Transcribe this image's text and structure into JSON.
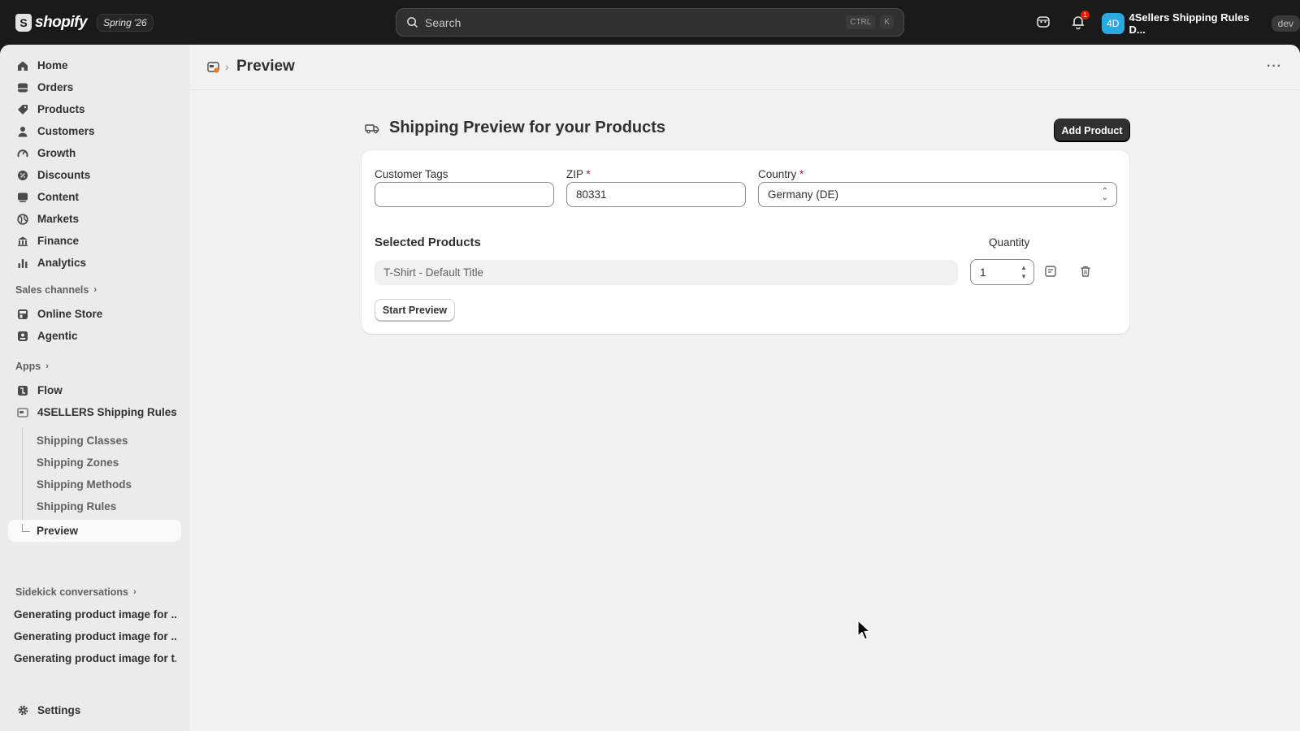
{
  "topbar": {
    "brand_name": "shopify",
    "brand_logo_letter": "S",
    "version": "Spring '26",
    "search_placeholder": "Search",
    "shortcut_keys": [
      "CTRL",
      "K"
    ],
    "notification_count": "1",
    "store_initials": "4D",
    "store_name": "4Sellers Shipping Rules D...",
    "env_badge": "dev"
  },
  "sidebar": {
    "items": [
      {
        "label": "Home",
        "icon": "home-icon"
      },
      {
        "label": "Orders",
        "icon": "orders-icon"
      },
      {
        "label": "Products",
        "icon": "tag-icon"
      },
      {
        "label": "Customers",
        "icon": "person-icon"
      },
      {
        "label": "Growth",
        "icon": "gauge-icon"
      },
      {
        "label": "Discounts",
        "icon": "discount-icon"
      },
      {
        "label": "Content",
        "icon": "content-icon"
      },
      {
        "label": "Markets",
        "icon": "globe-icon"
      },
      {
        "label": "Finance",
        "icon": "bank-icon"
      },
      {
        "label": "Analytics",
        "icon": "bar-chart-icon"
      }
    ],
    "sales_channels_label": "Sales channels",
    "sales_channels": [
      {
        "label": "Online Store",
        "icon": "store-icon"
      },
      {
        "label": "Agentic",
        "icon": "agent-icon"
      }
    ],
    "apps_label": "Apps",
    "apps": [
      {
        "label": "Flow",
        "icon": "flow-icon"
      },
      {
        "label": "4SELLERS Shipping Rules",
        "icon": "shipping-app-icon"
      }
    ],
    "app_sub_items": [
      "Shipping Classes",
      "Shipping Zones",
      "Shipping Methods",
      "Shipping Rules"
    ],
    "active_sub_item": "Preview",
    "sidekick_label": "Sidekick conversations",
    "sidekick_items": [
      "Generating product image for ...",
      "Generating product image for ...",
      "Generating product image for t..."
    ],
    "settings_label": "Settings"
  },
  "main": {
    "page_title": "Preview",
    "card_title": "Shipping Preview for your Products",
    "add_product_label": "Add Product",
    "fields": {
      "customer_tags_label": "Customer Tags",
      "customer_tags_value": "",
      "zip_label": "ZIP",
      "zip_value": "80331",
      "country_label": "Country",
      "country_value": "Germany (DE)",
      "required_mark": "*"
    },
    "selected_products_label": "Selected Products",
    "quantity_label": "Quantity",
    "products": [
      {
        "name": "T-Shirt - Default Title",
        "quantity": "1"
      }
    ],
    "start_preview_label": "Start Preview"
  },
  "colors": {
    "topbar_bg": "#1a1a1a",
    "sidebar_bg": "#ebebeb",
    "main_bg": "#f1f1f1",
    "primary_button": "#303030",
    "required": "#c70a24",
    "avatar": "#2aa9e0"
  }
}
